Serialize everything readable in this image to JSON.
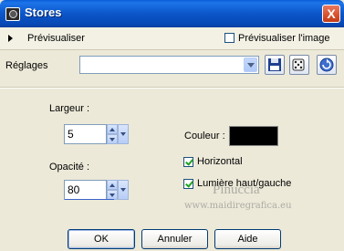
{
  "window": {
    "title": "Stores",
    "close_label": "X"
  },
  "preview": {
    "toggle_label": "Prévisualiser",
    "checkbox_label": "Prévisualiser l'image",
    "checked": false
  },
  "presets": {
    "label": "Réglages",
    "value": ""
  },
  "width": {
    "label": "Largeur :",
    "value": "5"
  },
  "opacity": {
    "label": "Opacité :",
    "value": "80"
  },
  "color": {
    "label": "Couleur :",
    "value": "#000000"
  },
  "horizontal": {
    "label": "Horizontal",
    "checked": true
  },
  "light": {
    "label": "Lumière haut/gauche",
    "checked": true
  },
  "watermark": {
    "line1": "Pinuccia",
    "line2": "www.maidiregrafica.eu"
  },
  "buttons": {
    "ok": "OK",
    "cancel": "Annuler",
    "help": "Aide"
  },
  "icons": {
    "save": "save-disk-icon",
    "random": "dice-icon",
    "reset": "reset-arrow-icon"
  }
}
